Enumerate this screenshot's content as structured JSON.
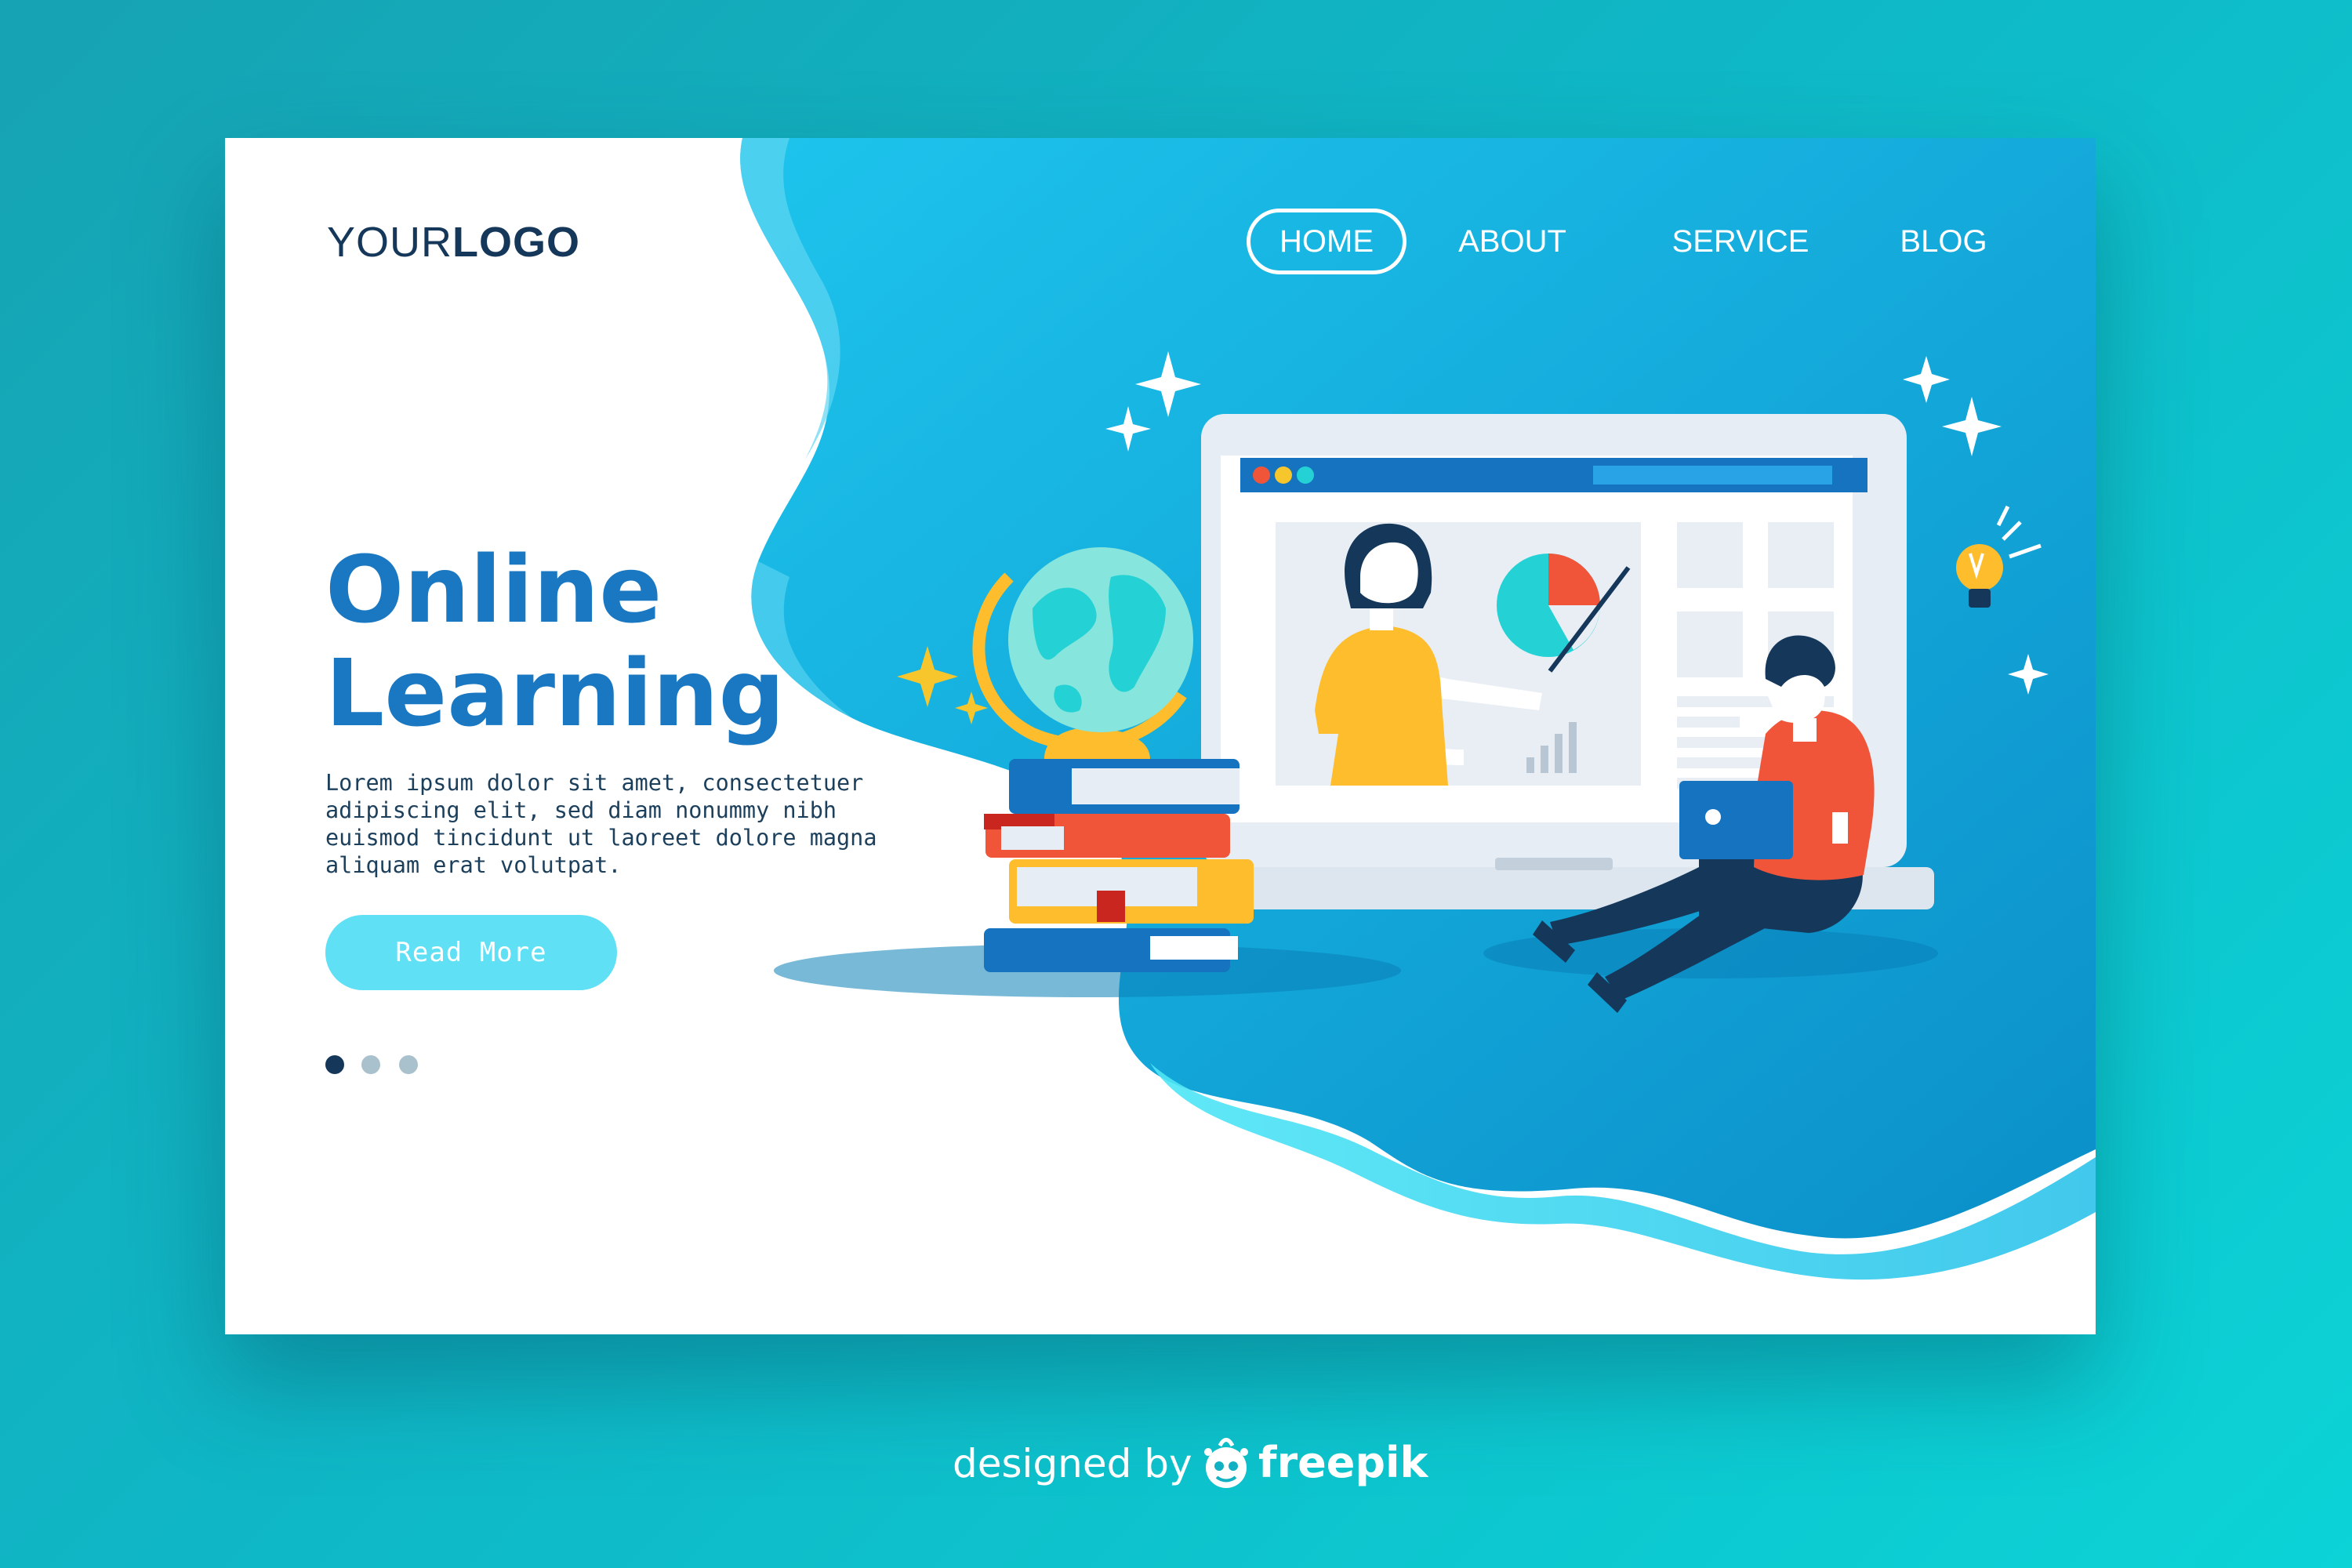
{
  "logo": {
    "part1": "YOUR",
    "part2": "LOGO"
  },
  "nav": {
    "items": [
      {
        "label": "HOME",
        "active": true
      },
      {
        "label": "ABOUT",
        "active": false
      },
      {
        "label": "SERVICE",
        "active": false
      },
      {
        "label": "BLOG",
        "active": false
      }
    ]
  },
  "hero": {
    "title_line1": "Online",
    "title_line2": "Learning",
    "body": "Lorem ipsum dolor sit amet, consectetuer adipiscing elit, sed diam nonummy nibh euismod tincidunt ut laoreet dolore magna aliquam erat volutpat.",
    "button_label": "Read More"
  },
  "carousel": {
    "slides": 3,
    "active_index": 1
  },
  "credit": {
    "prefix": "designed by",
    "brand": "freepik"
  },
  "colors": {
    "accent": "#1a78c2",
    "dark": "#14375a",
    "button": "#5fe0f5",
    "blue_panel": "#08aee0",
    "background": "#0fb7c6"
  },
  "icons": [
    "sparkle-icon",
    "globe-icon",
    "lightbulb-icon",
    "pie-chart-icon",
    "bar-chart-icon",
    "freepik-logo-icon"
  ]
}
